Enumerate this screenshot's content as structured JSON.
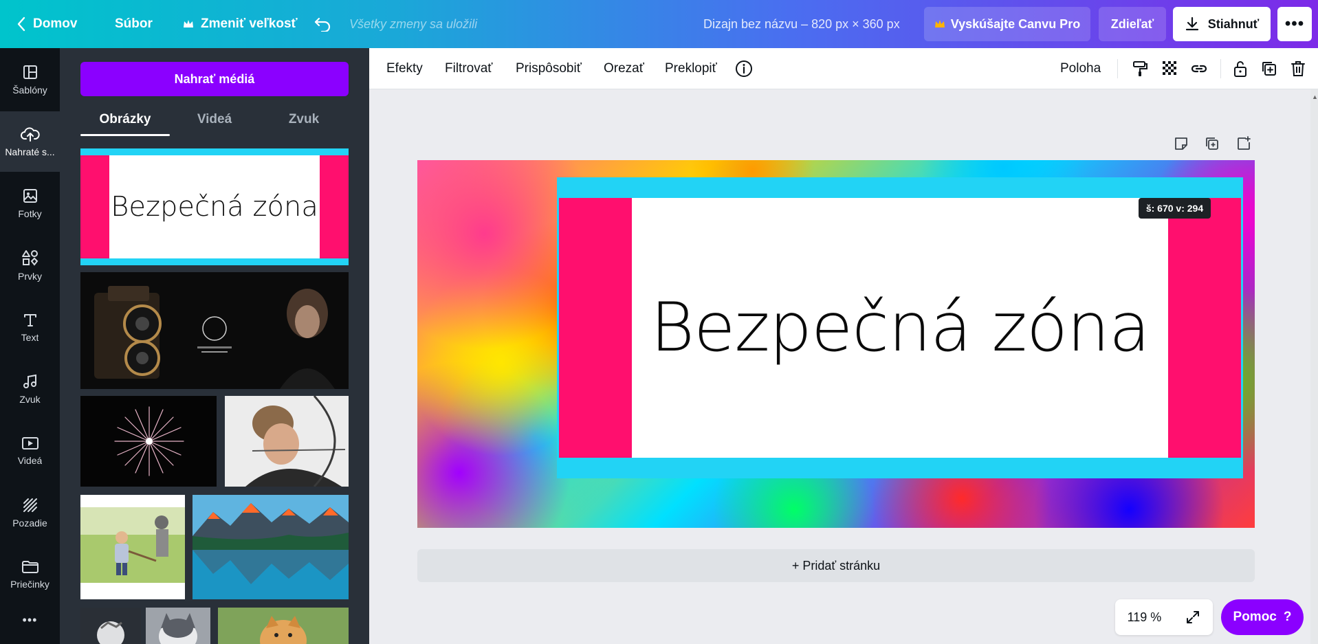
{
  "topbar": {
    "home": "Domov",
    "file": "Súbor",
    "resize": "Zmeniť veľkosť",
    "saved_status": "Všetky zmeny sa uložili",
    "design_title": "Dizajn bez názvu – 820 px × 360 px",
    "try_pro": "Vyskúšajte Canvu Pro",
    "share": "Zdieľať",
    "download": "Stiahnuť",
    "more": "•••"
  },
  "rail": {
    "items": [
      {
        "label": "Šablóny",
        "icon": "templates-icon"
      },
      {
        "label": "Nahraté s...",
        "icon": "upload-cloud-icon"
      },
      {
        "label": "Fotky",
        "icon": "photo-icon"
      },
      {
        "label": "Prvky",
        "icon": "shapes-icon"
      },
      {
        "label": "Text",
        "icon": "text-icon"
      },
      {
        "label": "Zvuk",
        "icon": "music-note-icon"
      },
      {
        "label": "Videá",
        "icon": "video-icon"
      },
      {
        "label": "Pozadie",
        "icon": "background-icon"
      },
      {
        "label": "Priečinky",
        "icon": "folder-icon"
      }
    ],
    "more": "•••"
  },
  "panel": {
    "upload_button": "Nahrať médiá",
    "tabs": [
      "Obrázky",
      "Videá",
      "Zvuk"
    ],
    "safe_zone_thumb_text": "Bezpečná zóna"
  },
  "edit_toolbar": {
    "effects": "Efekty",
    "filter": "Filtrovať",
    "adjust": "Prispôsobiť",
    "crop": "Orezať",
    "flip": "Preklopiť",
    "position": "Poloha"
  },
  "canvas": {
    "safe_zone_text": "Bezpečná zóna",
    "dimension_tooltip": "š: 670 v: 294",
    "add_page": "+ Pridať stránku"
  },
  "footer": {
    "zoom": "119 %",
    "help": "Pomoc",
    "help_icon": "?"
  },
  "colors": {
    "accent": "#8b00ff",
    "safe_cyan": "#22d3f5",
    "safe_pink": "#ff0f6e",
    "rail_bg": "#0e1318",
    "panel_bg": "#293039"
  }
}
